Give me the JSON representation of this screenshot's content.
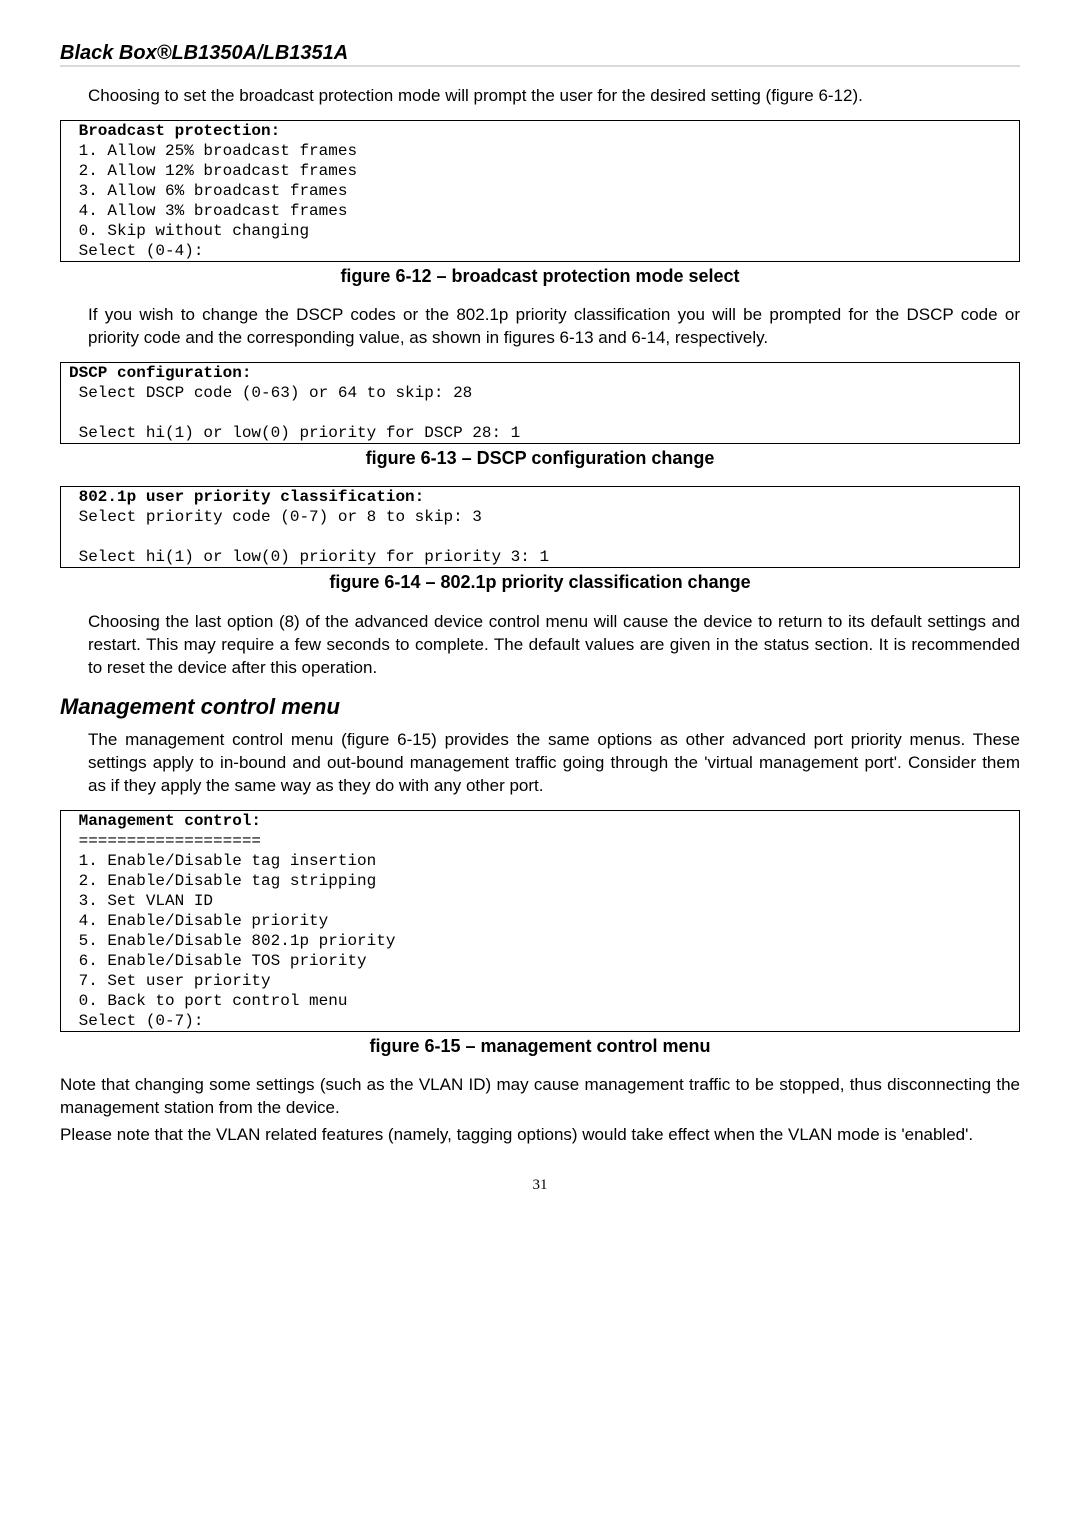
{
  "header": {
    "title": "Black Box®LB1350A/LB1351A"
  },
  "p1": "Choosing to set the broadcast protection mode will prompt the user for the desired setting (figure 6-12).",
  "code1": {
    "title": " Broadcast protection:",
    "l1": " 1. Allow 25% broadcast frames",
    "l2": " 2. Allow 12% broadcast frames",
    "l3": " 3. Allow 6% broadcast frames",
    "l4": " 4. Allow 3% broadcast frames",
    "l5": " 0. Skip without changing",
    "l6": " Select (0-4):"
  },
  "cap1": "figure 6-12 – broadcast protection mode select",
  "p2": "If you wish to change the DSCP codes or the 802.1p priority classification you will be prompted for the DSCP code or priority code and the corresponding value, as shown in figures 6-13 and 6-14, respectively.",
  "code2": {
    "title": "DSCP configuration:",
    "l1": " Select DSCP code (0-63) or 64 to skip: 28",
    "blank": " ",
    "l2": " Select hi(1) or low(0) priority for DSCP 28: 1"
  },
  "cap2": "figure 6-13 – DSCP configuration change",
  "code3": {
    "title": " 802.1p user priority classification:",
    "l1": " Select priority code (0-7) or 8 to skip: 3",
    "blank": " ",
    "l2": " Select hi(1) or low(0) priority for priority 3: 1"
  },
  "cap3": "figure 6-14 – 802.1p priority classification change",
  "p3": "Choosing the last option (8) of the advanced device control menu will cause the device to return to its default settings and restart. This may require a few seconds to complete. The default values are given in the status section. It is recommended to reset the device after this operation.",
  "section": "Management control menu",
  "p4": "The management control menu (figure 6-15) provides the same options as other advanced port priority menus. These settings apply to in-bound and out-bound management traffic going through the 'virtual management port'. Consider them as if they apply the same way as they do with any other port.",
  "code4": {
    "title": " Management control:",
    "rule": " ===================",
    "l1": " 1. Enable/Disable tag insertion",
    "l2": " 2. Enable/Disable tag stripping",
    "l3": " 3. Set VLAN ID",
    "l4": " 4. Enable/Disable priority",
    "l5": " 5. Enable/Disable 802.1p priority",
    "l6": " 6. Enable/Disable TOS priority",
    "l7": " 7. Set user priority",
    "l8": " 0. Back to port control menu",
    "l9": " Select (0-7):"
  },
  "cap4": "figure 6-15 – management control menu",
  "p5": "Note that changing some settings (such as the VLAN ID) may cause management traffic to be stopped, thus disconnecting the management station from the device.",
  "p6": "Please note that the VLAN related features (namely, tagging options) would take effect when the VLAN mode is 'enabled'.",
  "pagenum": "31"
}
